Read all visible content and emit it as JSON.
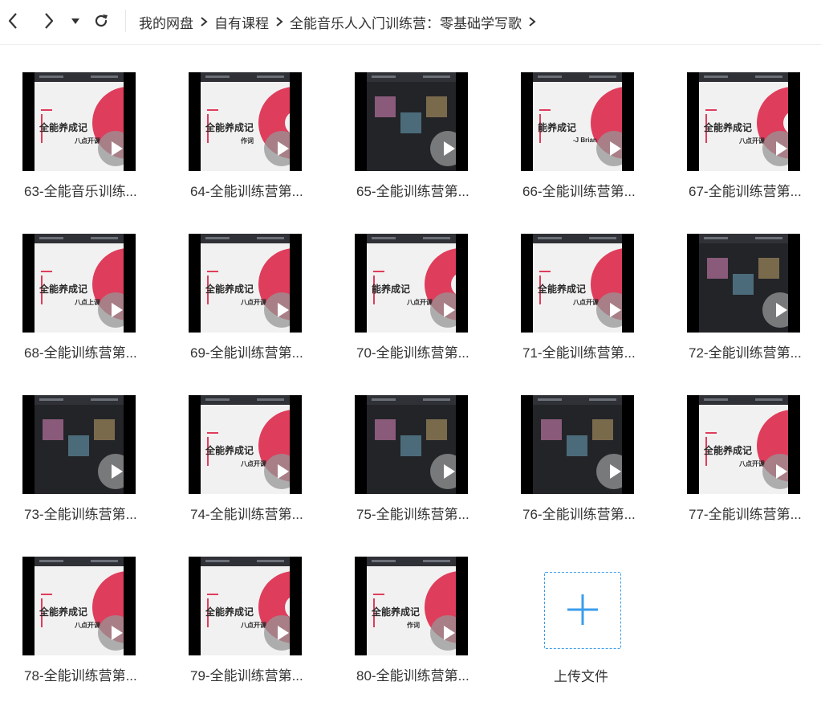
{
  "toolbar": {
    "breadcrumbs": [
      "我的网盘",
      "自有课程",
      "全能音乐人入门训练营：零基础学写歌"
    ]
  },
  "files": [
    {
      "name": "63-全能音乐训练...",
      "thumb_title": "全能养成记",
      "thumb_sub": "八点开课"
    },
    {
      "name": "64-全能训练营第...",
      "thumb_title": "全能养成记",
      "thumb_sub": "作词"
    },
    {
      "name": "65-全能训练营第...",
      "thumb_title": "",
      "thumb_sub": ""
    },
    {
      "name": "66-全能训练营第...",
      "thumb_title": "能养成记",
      "thumb_sub": "-J Brian"
    },
    {
      "name": "67-全能训练营第...",
      "thumb_title": "全能养成记",
      "thumb_sub": "八点开课"
    },
    {
      "name": "68-全能训练营第...",
      "thumb_title": "全能养成记",
      "thumb_sub": "八点上课"
    },
    {
      "name": "69-全能训练营第...",
      "thumb_title": "全能养成记",
      "thumb_sub": "八点开课"
    },
    {
      "name": "70-全能训练营第...",
      "thumb_title": "能养成记",
      "thumb_sub": "八点开课"
    },
    {
      "name": "71-全能训练营第...",
      "thumb_title": "全能养成记",
      "thumb_sub": "八点开课"
    },
    {
      "name": "72-全能训练营第...",
      "thumb_title": "",
      "thumb_sub": ""
    },
    {
      "name": "73-全能训练营第...",
      "thumb_title": "",
      "thumb_sub": ""
    },
    {
      "name": "74-全能训练营第...",
      "thumb_title": "全能养成记",
      "thumb_sub": "八点开课"
    },
    {
      "name": "75-全能训练营第...",
      "thumb_title": "",
      "thumb_sub": ""
    },
    {
      "name": "76-全能训练营第...",
      "thumb_title": "",
      "thumb_sub": ""
    },
    {
      "name": "77-全能训练营第...",
      "thumb_title": "全能养成记",
      "thumb_sub": "八点开课"
    },
    {
      "name": "78-全能训练营第...",
      "thumb_title": "全能养成记",
      "thumb_sub": "八点开课"
    },
    {
      "name": "79-全能训练营第...",
      "thumb_title": "全能养成记",
      "thumb_sub": "八点开课"
    },
    {
      "name": "80-全能训练营第...",
      "thumb_title": "全能养成记",
      "thumb_sub": "作词"
    }
  ],
  "upload": {
    "label": "上传文件"
  },
  "colors": {
    "accent": "#df3d5c",
    "upload_border": "#3b9ded",
    "play_overlay": "#969696"
  }
}
